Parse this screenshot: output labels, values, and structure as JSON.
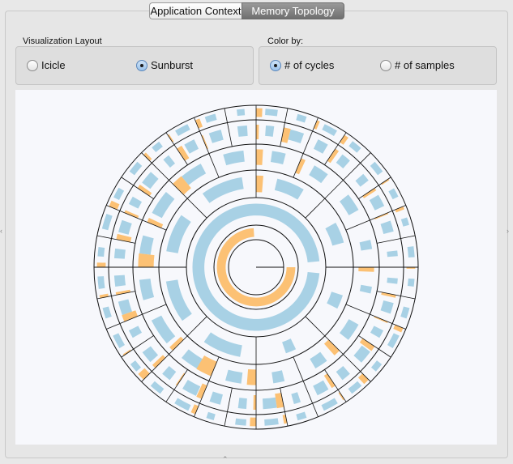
{
  "tabs": [
    {
      "label": "Application Context",
      "active": false
    },
    {
      "label": "Memory Topology",
      "active": true
    }
  ],
  "layout_group": {
    "title": "Visualization Layout",
    "options": [
      {
        "label": "Icicle",
        "selected": false
      },
      {
        "label": "Sunburst",
        "selected": true
      }
    ]
  },
  "color_group": {
    "title": "Color by:",
    "options": [
      {
        "label": "# of cycles",
        "selected": true
      },
      {
        "label": "# of samples",
        "selected": false
      }
    ]
  },
  "colors": {
    "cycles": "#fcc174",
    "samples": "#a8d1e5",
    "ring_line": "#111111",
    "canvas_bg": "#f7f8fc"
  },
  "sunburst": {
    "levels": [
      {
        "divisions": 1,
        "samples": [
          0.0
        ],
        "cycles": [
          0.0
        ]
      },
      {
        "divisions": 1,
        "samples": [
          0.0
        ],
        "cycles": [
          0.74
        ]
      },
      {
        "divisions": 1,
        "samples": [
          0.97
        ],
        "cycles": [
          0.0
        ]
      },
      {
        "divisions": 8,
        "samples": [
          0.2,
          0.15,
          0.55,
          0.6,
          0.55,
          0.6,
          0.4,
          0.3
        ],
        "cycles": [
          0.0,
          0.0,
          0.0,
          0.0,
          0.0,
          0.0,
          0.1,
          0.0
        ]
      },
      {
        "divisions": 16,
        "samples": [
          0.15,
          0.4,
          0.3,
          0.25,
          0.35,
          0.5,
          0.6,
          0.45,
          0.4,
          0.55,
          0.5,
          0.45,
          0.3,
          0.35,
          0.4,
          0.2
        ],
        "cycles": [
          0.1,
          0.0,
          0.15,
          0.0,
          0.2,
          0.35,
          0.1,
          0.0,
          0.3,
          0.1,
          0.25,
          0.0,
          0.15,
          0.1,
          0.0,
          0.0
        ]
      },
      {
        "divisions": 32,
        "samples": [
          0.2,
          0.4,
          0.3,
          0.5,
          0.35,
          0.45,
          0.25,
          0.5,
          0.3,
          0.4,
          0.55,
          0.35,
          0.45,
          0.3,
          0.5,
          0.4,
          0.35,
          0.45,
          0.3,
          0.5,
          0.25,
          0.4,
          0.45,
          0.35,
          0.3,
          0.5,
          0.4,
          0.35,
          0.3,
          0.45,
          0.4,
          0.2
        ],
        "cycles": [
          0.0,
          0.1,
          0.05,
          0.2,
          0.0,
          0.15,
          0.0,
          0.25,
          0.1,
          0.0,
          0.2,
          0.05,
          0.15,
          0.0,
          0.25,
          0.1,
          0.0,
          0.2,
          0.1,
          0.15,
          0.0,
          0.2,
          0.05,
          0.0,
          0.1,
          0.25,
          0.0,
          0.15,
          0.0,
          0.1,
          0.05,
          0.0
        ]
      },
      {
        "divisions": 32,
        "samples": [
          0.25,
          0.35,
          0.45,
          0.3,
          0.4,
          0.5,
          0.3,
          0.45,
          0.35,
          0.25,
          0.5,
          0.4,
          0.3,
          0.45,
          0.35,
          0.4,
          0.3,
          0.5,
          0.35,
          0.4,
          0.3,
          0.45,
          0.35,
          0.25,
          0.4,
          0.3,
          0.45,
          0.35,
          0.4,
          0.3,
          0.25,
          0.35
        ],
        "cycles": [
          0.05,
          0.0,
          0.15,
          0.0,
          0.2,
          0.05,
          0.0,
          0.1,
          0.2,
          0.0,
          0.15,
          0.0,
          0.25,
          0.05,
          0.0,
          0.1,
          0.15,
          0.0,
          0.2,
          0.0,
          0.1,
          0.05,
          0.15,
          0.0,
          0.2,
          0.0,
          0.1,
          0.15,
          0.0,
          0.05,
          0.1,
          0.0
        ]
      }
    ]
  }
}
